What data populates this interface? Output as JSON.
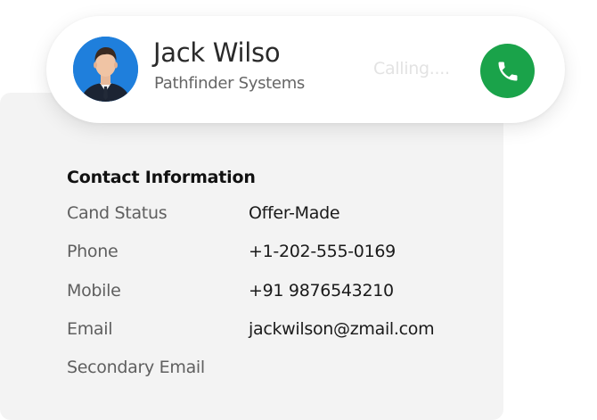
{
  "caller": {
    "name": "Jack Wilso",
    "company": "Pathfinder Systems",
    "status": "Calling....",
    "avatar_bg": "#1f7fdc",
    "call_button_color": "#1aa34a",
    "call_icon": "phone-icon"
  },
  "contact": {
    "title": "Contact Information",
    "fields": [
      {
        "label": "Cand Status",
        "value": "Offer-Made"
      },
      {
        "label": "Phone",
        "value": "+1-202-555-0169"
      },
      {
        "label": "Mobile",
        "value": "+91 9876543210"
      },
      {
        "label": "Email",
        "value": "jackwilson@zmail.com"
      },
      {
        "label": "Secondary Email",
        "value": ""
      }
    ]
  }
}
